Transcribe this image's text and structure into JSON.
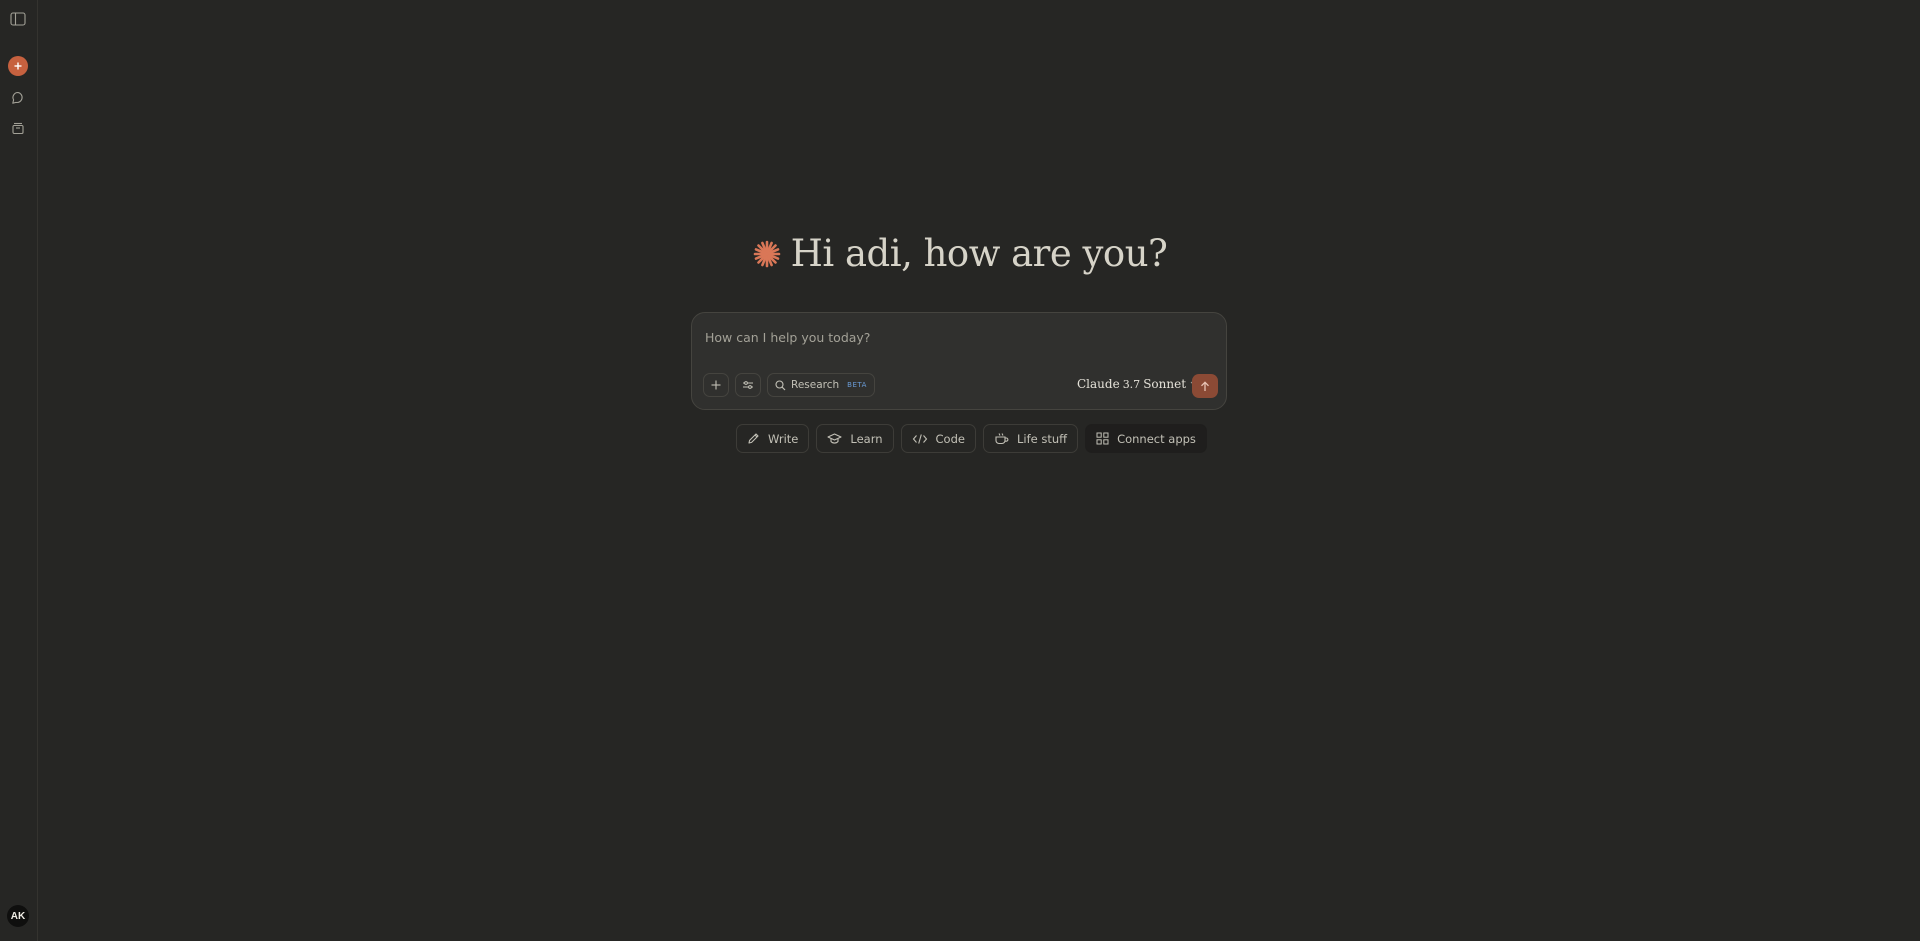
{
  "greeting": {
    "text": "Hi adi, how are you?"
  },
  "composer": {
    "placeholder": "How can I help you today?",
    "research_label": "Research",
    "research_badge": "BETA",
    "model": {
      "name": "Claude",
      "version": "3.7",
      "variant": "Sonnet"
    }
  },
  "chips": [
    {
      "label": "Write",
      "icon": "pencil-icon"
    },
    {
      "label": "Learn",
      "icon": "graduation-cap-icon"
    },
    {
      "label": "Code",
      "icon": "code-icon"
    },
    {
      "label": "Life stuff",
      "icon": "coffee-cup-icon"
    },
    {
      "label": "Connect apps",
      "icon": "grid-icon"
    }
  ],
  "user": {
    "initials": "AK"
  },
  "colors": {
    "accent": "#c6613f",
    "background": "#262624",
    "composer": "#30302e"
  }
}
